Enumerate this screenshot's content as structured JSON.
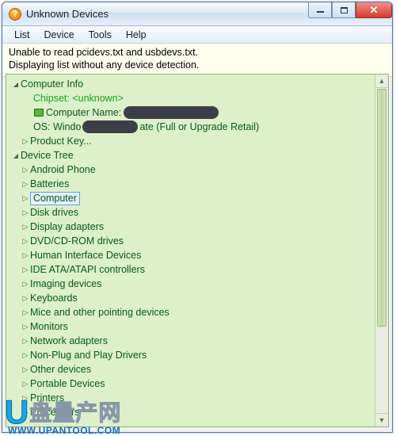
{
  "window": {
    "title": "Unknown Devices"
  },
  "menu": {
    "list": "List",
    "device": "Device",
    "tools": "Tools",
    "help": "Help"
  },
  "warning": {
    "line1": "Unable to read pcidevs.txt and usbdevs.txt.",
    "line2": "Displaying list without any device detection."
  },
  "tree": {
    "computerInfo": {
      "label": "Computer Info",
      "chipset": "Chipset: <unknown>",
      "computerName": "Computer Name:",
      "os_prefix": "OS: Windo",
      "os_suffix": "ate  (Full or Upgrade Retail)",
      "productKey": "Product Key..."
    },
    "deviceTree": {
      "label": "Device Tree",
      "items": [
        "Android Phone",
        "Batteries",
        "Computer",
        "Disk drives",
        "Display adapters",
        "DVD/CD-ROM drives",
        "Human Interface Devices",
        "IDE ATA/ATAPI controllers",
        "Imaging devices",
        "Keyboards",
        "Mice and other pointing devices",
        "Monitors",
        "Network adapters",
        "Non-Plug and Play Drivers",
        "Other devices",
        "Portable Devices",
        "Printers",
        "Processors"
      ],
      "selectedIndex": 2
    }
  },
  "watermark": {
    "text": "盘量产网",
    "url": "WWW.UPANTOOL.COM"
  }
}
